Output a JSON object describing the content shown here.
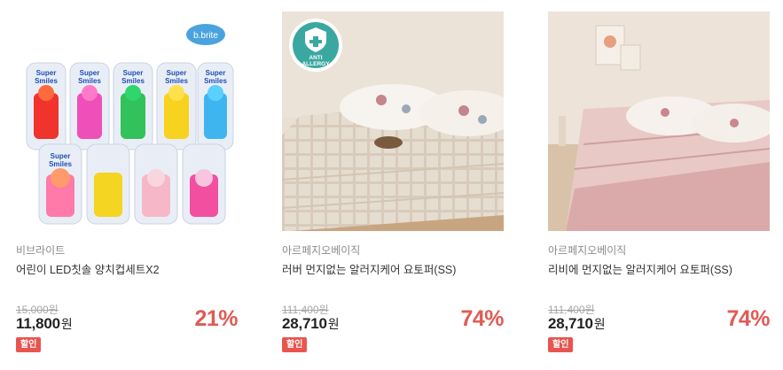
{
  "products": [
    {
      "brand": "비브라이트",
      "title": "어린이 LED칫솔 양치컵세트X2",
      "original_price": "15,000원",
      "price": "11,800",
      "price_unit": "원",
      "discount": "21%",
      "badge": "할인",
      "image_logo": "b.brite",
      "image_package_text": [
        "Super",
        "Smiles"
      ]
    },
    {
      "brand": "아르페지오베이직",
      "title": "러버 먼지없는 알러지케어 요토퍼(SS)",
      "original_price": "111,400원",
      "price": "28,710",
      "price_unit": "원",
      "discount": "74%",
      "badge": "할인",
      "image_badge": [
        "ANTI",
        "ALLERGY"
      ]
    },
    {
      "brand": "아르페지오베이직",
      "title": "리비에 먼지없는 알러지케어 요토퍼(SS)",
      "original_price": "111,400원",
      "price": "28,710",
      "price_unit": "원",
      "discount": "74%",
      "badge": "할인"
    }
  ],
  "colors": {
    "discount": "#e05b55",
    "badge_bg": "#e8554e",
    "brand_text": "#8b8b8b",
    "strike_text": "#a6a6a6"
  }
}
